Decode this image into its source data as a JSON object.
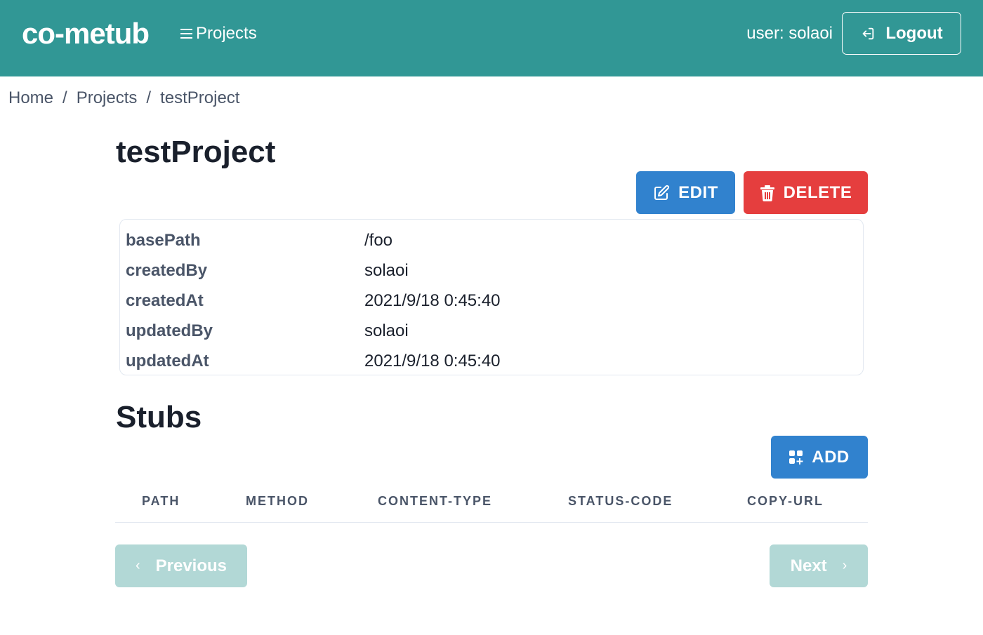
{
  "navbar": {
    "logo": "co-metub",
    "projects_link": "Projects",
    "user_label": "user: solaoi",
    "logout_label": "Logout"
  },
  "breadcrumb": {
    "items": [
      "Home",
      "Projects",
      "testProject"
    ],
    "separator": "/"
  },
  "project": {
    "title": "testProject",
    "edit_label": "EDIT",
    "delete_label": "DELETE",
    "details": [
      {
        "key": "basePath",
        "value": "/foo"
      },
      {
        "key": "createdBy",
        "value": "solaoi"
      },
      {
        "key": "createdAt",
        "value": "2021/9/18 0:45:40"
      },
      {
        "key": "updatedBy",
        "value": "solaoi"
      },
      {
        "key": "updatedAt",
        "value": "2021/9/18 0:45:40"
      }
    ]
  },
  "stubs": {
    "title": "Stubs",
    "add_label": "ADD",
    "columns": [
      "PATH",
      "METHOD",
      "CONTENT-TYPE",
      "STATUS-CODE",
      "COPY-URL"
    ],
    "rows": []
  },
  "pagination": {
    "previous_label": "Previous",
    "next_label": "Next",
    "previous_icon": "‹",
    "next_icon": "›"
  },
  "colors": {
    "navbar_bg": "#319795",
    "primary": "#3182ce",
    "danger": "#e53e3e",
    "disabled_teal": "#b2d8d6"
  }
}
